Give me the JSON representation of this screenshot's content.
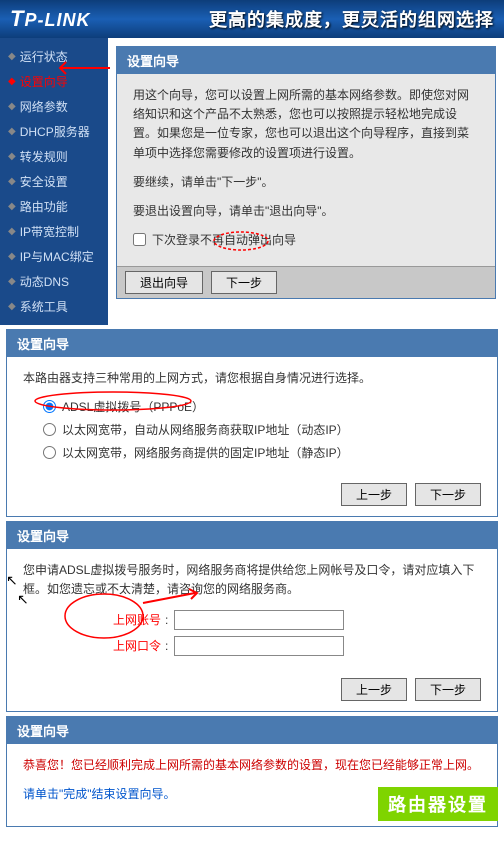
{
  "header": {
    "logo": "TP-LINK",
    "slogan": "更高的集成度，更灵活的组网选择"
  },
  "sidebar": {
    "items": [
      {
        "label": "运行状态"
      },
      {
        "label": "设置向导"
      },
      {
        "label": "网络参数"
      },
      {
        "label": "DHCP服务器"
      },
      {
        "label": "转发规则"
      },
      {
        "label": "安全设置"
      },
      {
        "label": "路由功能"
      },
      {
        "label": "IP带宽控制"
      },
      {
        "label": "IP与MAC绑定"
      },
      {
        "label": "动态DNS"
      },
      {
        "label": "系统工具"
      }
    ]
  },
  "panel1": {
    "title": "设置向导",
    "desc": "用这个向导，您可以设置上网所需的基本网络参数。即使您对网络知识和这个产品不太熟悉，您也可以按照提示轻松地完成设置。如果您是一位专家，您也可以退出这个向导程序，直接到菜单项中选择您需要修改的设置项进行设置。",
    "continue_text": "要继续，请单击\"下一步\"。",
    "exit_text": "要退出设置向导，请单击\"退出向导\"。",
    "checkbox_label": "下次登录不再自动弹出向导",
    "btn_exit": "退出向导",
    "btn_next": "下一步"
  },
  "panel2": {
    "title": "设置向导",
    "desc": "本路由器支持三种常用的上网方式，请您根据自身情况进行选择。",
    "options": [
      {
        "label": "ADSL虚拟拨号（PPPoE）"
      },
      {
        "label": "以太网宽带，自动从网络服务商获取IP地址（动态IP）"
      },
      {
        "label": "以太网宽带，网络服务商提供的固定IP地址（静态IP）"
      }
    ],
    "btn_prev": "上一步",
    "btn_next": "下一步"
  },
  "panel3": {
    "title": "设置向导",
    "desc": "您申请ADSL虚拟拨号服务时，网络服务商将提供给您上网帐号及口令，请对应填入下框。如您遗忘或不太清楚，请咨询您的网络服务商。",
    "label_user": "上网账号",
    "label_pass": "上网口令",
    "btn_prev": "上一步",
    "btn_next": "下一步"
  },
  "panel4": {
    "title": "设置向导",
    "desc_red": "恭喜您！您已经顺利完成上网所需的基本网络参数的设置，现在您已经能够正常上网。",
    "desc_blue": "请单击\"完成\"结束设置向导。"
  },
  "watermark": "路由器设置"
}
